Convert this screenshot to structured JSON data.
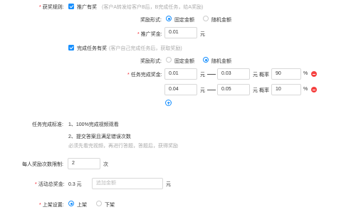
{
  "prize_rule": {
    "label": "获奖规则:",
    "referral": {
      "title": "推广有奖",
      "hint": "(客户A转发给客户B后，B完成任务，给A奖励)",
      "reward_form_label": "奖励形式:",
      "options": [
        "固定金额",
        "随机金额"
      ],
      "selected": "固定金额",
      "bonus_label": "推广奖金:",
      "bonus_value": "0.01",
      "unit": "元"
    },
    "task": {
      "title": "完成任务有奖",
      "hint": "(客户自己完成任务后，获取奖励)",
      "reward_form_label": "奖励形式:",
      "options": [
        "固定金额",
        "随机金额"
      ],
      "selected": "随机金额",
      "bonus_label": "任务完成奖金:",
      "unit": "元",
      "prob_label": "概率",
      "percent": "%",
      "rows": [
        {
          "min": "0.01",
          "max": "0.03",
          "prob": "90"
        },
        {
          "min": "0.04",
          "max": "0.05",
          "prob": "10"
        }
      ]
    }
  },
  "criteria": {
    "label": "任务完成标准:",
    "item1": "1、100%完成视频观看",
    "item2": "2、提交答案且满足错误次数",
    "note": "必须先看完视频，再进行答题，答题后，获得奖励"
  },
  "per_person": {
    "label": "每人奖励次数限制:",
    "value": "2",
    "unit": "次"
  },
  "total": {
    "label": "活动总奖金:",
    "value_text": "0.3 元",
    "placeholder": "追加金额",
    "unit": "元"
  },
  "listing": {
    "label": "上架设置:",
    "options": [
      "上架",
      "下架"
    ],
    "selected": "上架"
  },
  "colors": {
    "accent": "#1890ff",
    "danger": "#f5403f",
    "required": "#f5222d"
  }
}
